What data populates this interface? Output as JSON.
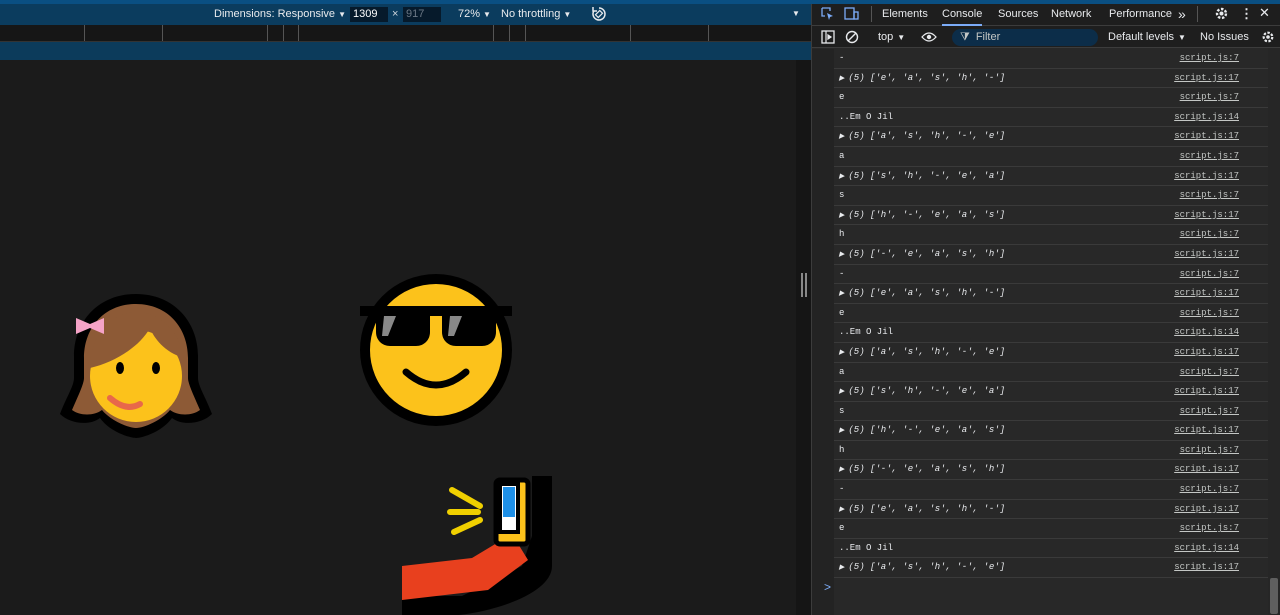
{
  "devbar": {
    "dimensions_label": "Dimensions: Responsive",
    "width_value": "1309",
    "height_placeholder": "917",
    "times": "×",
    "zoom": "72%",
    "throttling": "No throttling"
  },
  "devtools": {
    "tabs": [
      "Elements",
      "Console",
      "Sources",
      "Network",
      "Performance"
    ],
    "more": "»",
    "context": "top",
    "filter_placeholder": "Filter",
    "levels": "Default levels",
    "issues": "No Issues"
  },
  "console": {
    "rows": [
      {
        "msg": "-",
        "src": "script.js:7"
      },
      {
        "msg": "(5) ['e', 'a', 's', 'h', '-']",
        "src": "script.js:17",
        "arr": true
      },
      {
        "msg": "e",
        "src": "script.js:7"
      },
      {
        "msg": "..Em O Jil",
        "src": "script.js:14"
      },
      {
        "msg": "(5) ['a', 's', 'h', '-', 'e']",
        "src": "script.js:17",
        "arr": true
      },
      {
        "msg": "a",
        "src": "script.js:7"
      },
      {
        "msg": "(5) ['s', 'h', '-', 'e', 'a']",
        "src": "script.js:17",
        "arr": true
      },
      {
        "msg": "s",
        "src": "script.js:7"
      },
      {
        "msg": "(5) ['h', '-', 'e', 'a', 's']",
        "src": "script.js:17",
        "arr": true
      },
      {
        "msg": "h",
        "src": "script.js:7"
      },
      {
        "msg": "(5) ['-', 'e', 'a', 's', 'h']",
        "src": "script.js:17",
        "arr": true
      },
      {
        "msg": "-",
        "src": "script.js:7"
      },
      {
        "msg": "(5) ['e', 'a', 's', 'h', '-']",
        "src": "script.js:17",
        "arr": true
      },
      {
        "msg": "e",
        "src": "script.js:7"
      },
      {
        "msg": "..Em O Jil",
        "src": "script.js:14"
      },
      {
        "msg": "(5) ['a', 's', 'h', '-', 'e']",
        "src": "script.js:17",
        "arr": true
      },
      {
        "msg": "a",
        "src": "script.js:7"
      },
      {
        "msg": "(5) ['s', 'h', '-', 'e', 'a']",
        "src": "script.js:17",
        "arr": true
      },
      {
        "msg": "s",
        "src": "script.js:7"
      },
      {
        "msg": "(5) ['h', '-', 'e', 'a', 's']",
        "src": "script.js:17",
        "arr": true
      },
      {
        "msg": "h",
        "src": "script.js:7"
      },
      {
        "msg": "(5) ['-', 'e', 'a', 's', 'h']",
        "src": "script.js:17",
        "arr": true
      },
      {
        "msg": "-",
        "src": "script.js:7"
      },
      {
        "msg": "(5) ['e', 'a', 's', 'h', '-']",
        "src": "script.js:17",
        "arr": true
      },
      {
        "msg": "e",
        "src": "script.js:7"
      },
      {
        "msg": "..Em O Jil",
        "src": "script.js:14"
      },
      {
        "msg": "(5) ['a', 's', 'h', '-', 'e']",
        "src": "script.js:17",
        "arr": true
      }
    ],
    "prompt": ">"
  },
  "colors": {
    "accent": "#7cacf8",
    "devbar": "#0b3c5e",
    "emoji_yellow": "#fcc21b"
  },
  "icons": [
    "inspect-icon",
    "device-toggle-icon",
    "gear-icon",
    "kebab-icon",
    "sidebar-icon",
    "clear-icon",
    "eye-icon",
    "filter-icon",
    "rotate-icon"
  ]
}
